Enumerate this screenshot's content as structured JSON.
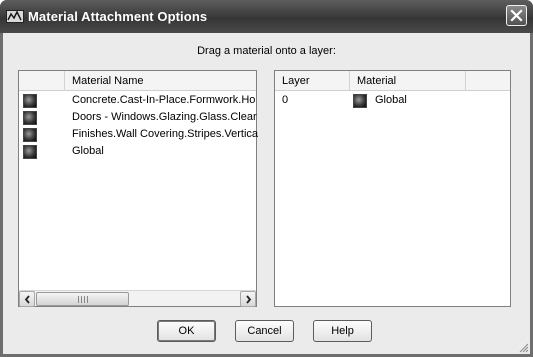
{
  "window": {
    "title": "Material Attachment Options"
  },
  "instruction": "Drag a material onto a layer:",
  "materials_panel": {
    "column_header": "Material Name",
    "items": [
      {
        "label": "Concrete.Cast-In-Place.Formwork.Ho"
      },
      {
        "label": "Doors - Windows.Glazing.Glass.Clear"
      },
      {
        "label": "Finishes.Wall Covering.Stripes.Vertica"
      },
      {
        "label": "Global"
      }
    ]
  },
  "layers_panel": {
    "column_headers": {
      "layer": "Layer",
      "material": "Material"
    },
    "rows": [
      {
        "layer": "0",
        "material": "Global"
      }
    ]
  },
  "buttons": {
    "ok": "OK",
    "cancel": "Cancel",
    "help": "Help"
  },
  "icons": {
    "app": "autocad-app-icon",
    "close": "close-icon",
    "material_swatch": "material-sphere-icon"
  }
}
